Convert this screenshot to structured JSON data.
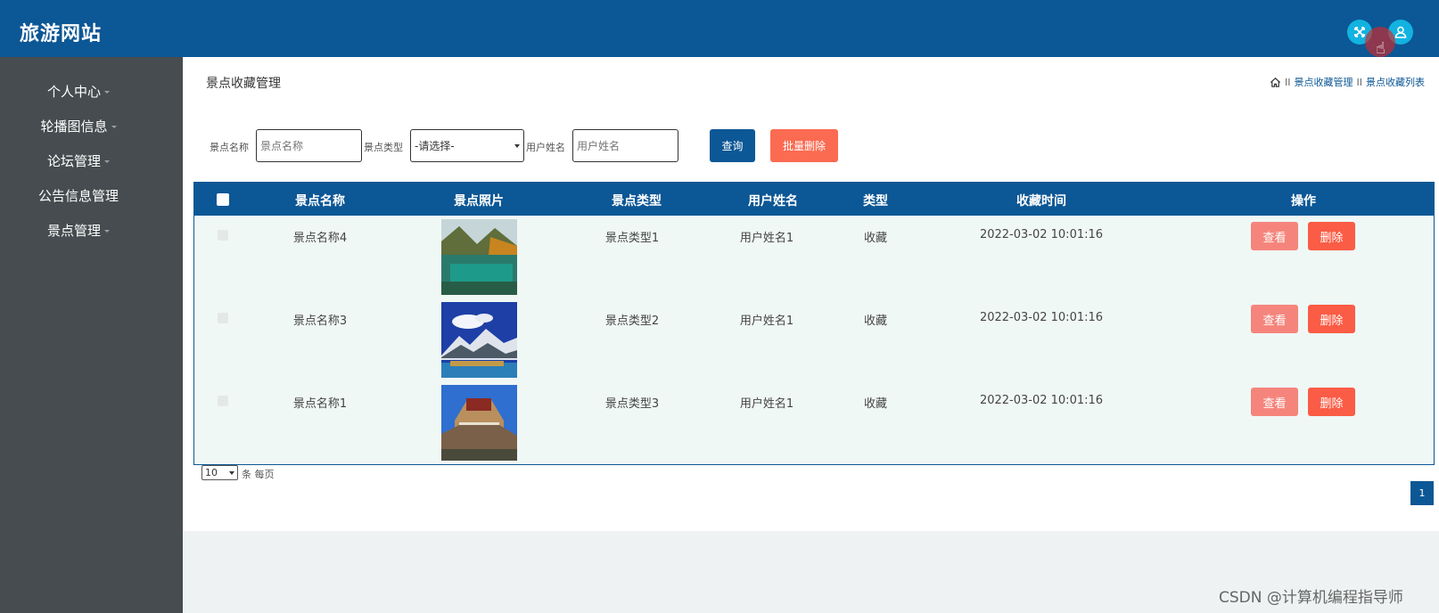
{
  "header": {
    "site_title": "旅游网站",
    "icons": [
      "fullscreen-icon",
      "user-icon"
    ],
    "accent_color": "#0c5795"
  },
  "sidebar": {
    "items": [
      {
        "label": "个人中心"
      },
      {
        "label": "轮播图信息"
      },
      {
        "label": "论坛管理"
      },
      {
        "label": "公告信息管理"
      },
      {
        "label": "景点管理"
      }
    ]
  },
  "main": {
    "page_title": "景点收藏管理",
    "breadcrumb": {
      "sep": "II",
      "items": [
        "景点收藏管理",
        "景点收藏列表"
      ]
    },
    "search": {
      "name_label": "景点名称",
      "name_placeholder": "景点名称",
      "type_label": "景点类型",
      "type_selected": "-请选择-",
      "user_label": "用户姓名",
      "user_placeholder": "用户姓名",
      "query_button": "查询",
      "batch_delete_button": "批量删除"
    },
    "table": {
      "headers": [
        "景点名称",
        "景点照片",
        "景点类型",
        "用户姓名",
        "类型",
        "收藏时间",
        "操作"
      ],
      "rows": [
        {
          "name": "景点名称4",
          "photo": "mountain-lake-photo",
          "type": "景点类型1",
          "user": "用户姓名1",
          "kind": "收藏",
          "time": "2022-03-02 10:01:16",
          "view": "查看",
          "delete": "删除"
        },
        {
          "name": "景点名称3",
          "photo": "snow-mountain-photo",
          "type": "景点类型2",
          "user": "用户姓名1",
          "kind": "收藏",
          "time": "2022-03-02 10:01:16",
          "view": "查看",
          "delete": "删除"
        },
        {
          "name": "景点名称1",
          "photo": "palace-photo",
          "type": "景点类型3",
          "user": "用户姓名1",
          "kind": "收藏",
          "time": "2022-03-02 10:01:16",
          "view": "查看",
          "delete": "删除"
        }
      ]
    },
    "pagination": {
      "page_size": "10",
      "page_size_label": "条 每页",
      "current_page": "1"
    }
  },
  "watermark": "CSDN @计算机编程指导师"
}
